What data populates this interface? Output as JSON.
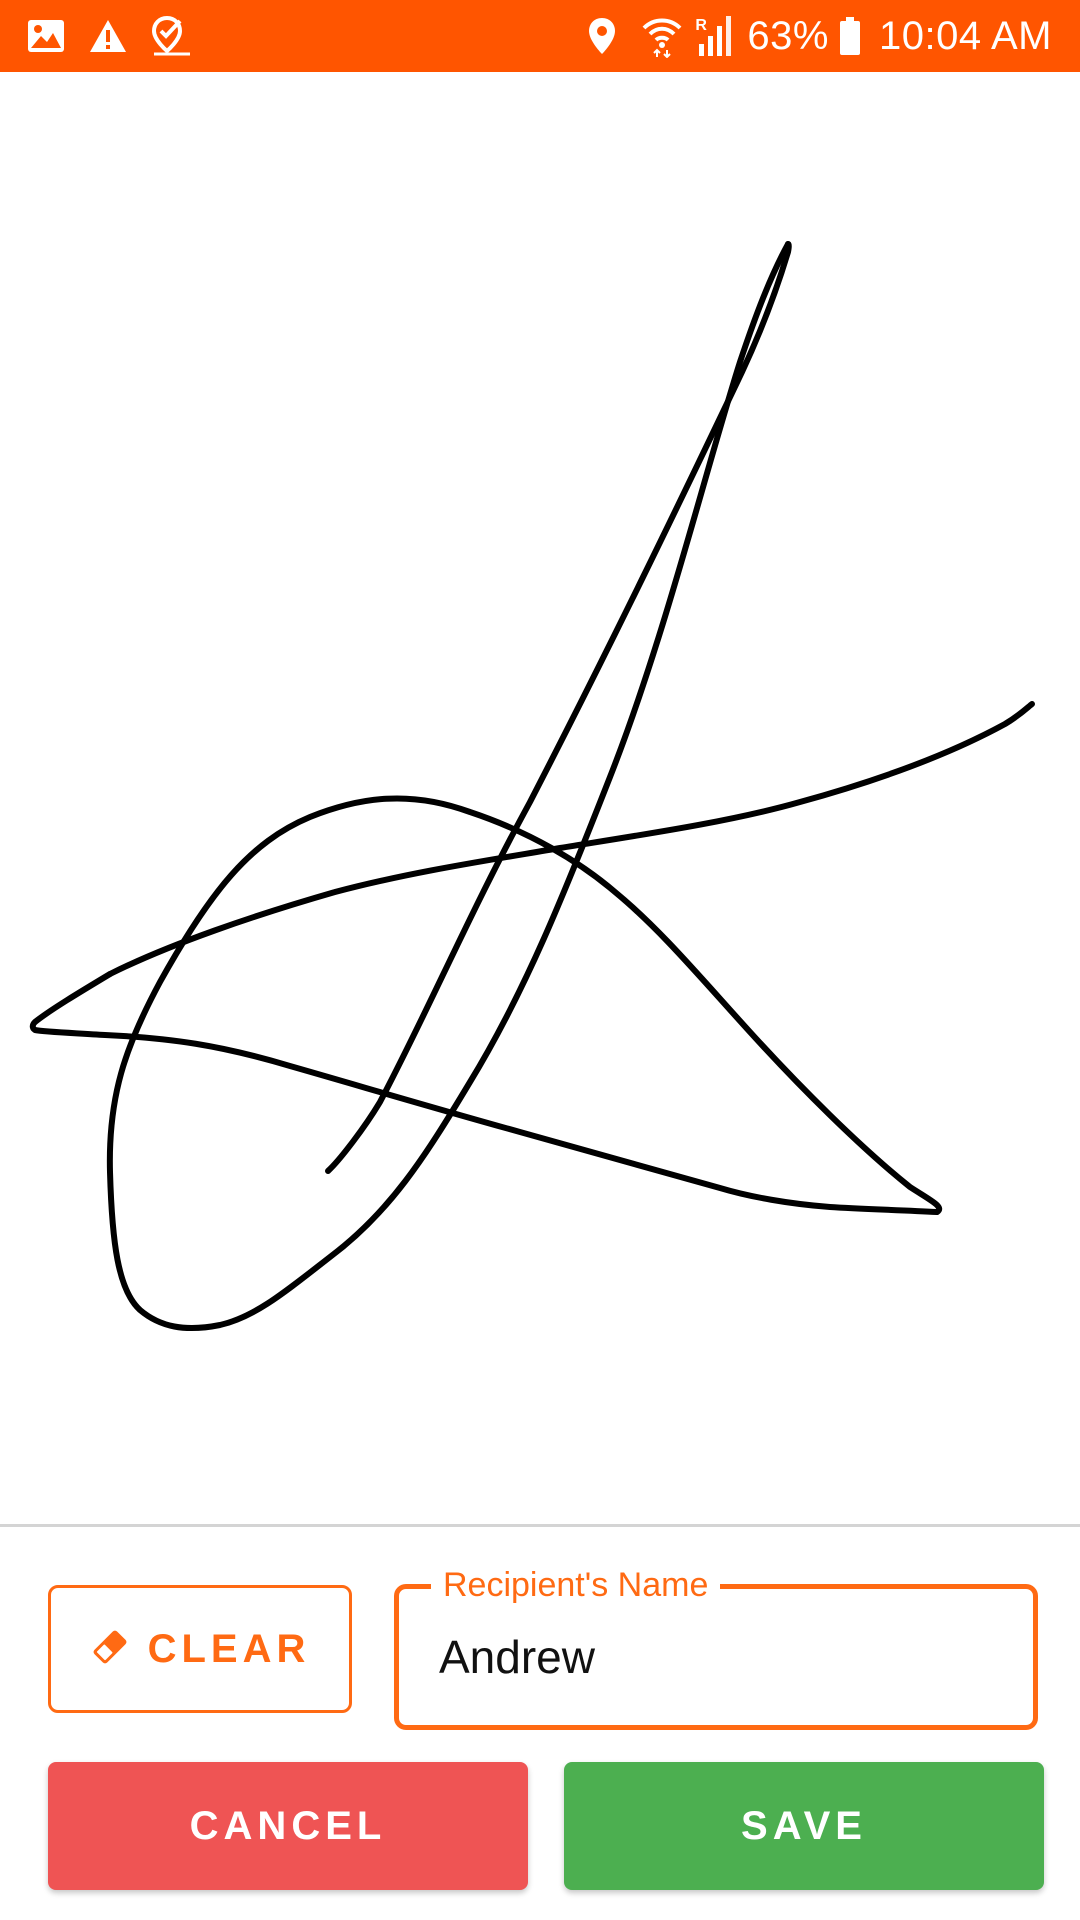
{
  "status_bar": {
    "color": "#ff5500",
    "left_icons": [
      "image-notification-icon",
      "warning-icon",
      "location-check-icon"
    ],
    "right_icons": [
      "location-pin-icon",
      "wifi-icon",
      "roaming-signal-icon",
      "battery-icon"
    ],
    "roaming_indicator": "R",
    "battery_percent": "63%",
    "time": "10:04 AM"
  },
  "signature": {
    "ink_color": "#000000",
    "has_signature": true
  },
  "controls": {
    "clear_label": "CLEAR",
    "cancel_label": "CANCEL",
    "save_label": "SAVE",
    "recipient_field": {
      "label": "Recipient's Name",
      "value": "Andrew"
    }
  },
  "colors": {
    "accent": "#ff6a13",
    "cancel": "#ef5454",
    "save": "#4caf50"
  }
}
